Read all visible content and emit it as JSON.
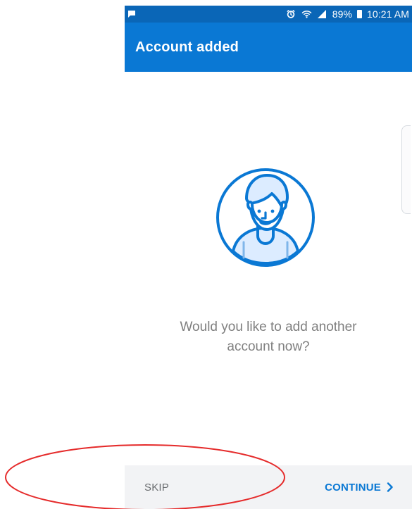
{
  "status_bar": {
    "battery_percent": "89%",
    "time": "10:21 AM",
    "icons": {
      "notification": "chat-bubble-icon",
      "alarm": "alarm-icon",
      "wifi": "wifi-icon",
      "signal": "signal-icon",
      "battery": "battery-icon"
    }
  },
  "app_bar": {
    "title": "Account added"
  },
  "main": {
    "avatar_icon": "person-avatar-icon",
    "message_line_1": "Would you like to add another",
    "message_line_2": "account now?"
  },
  "actions": {
    "skip_label": "SKIP",
    "continue_label": "CONTINUE",
    "continue_icon": "chevron-right-icon"
  },
  "colors": {
    "status_bar": "#0a66b7",
    "app_bar": "#0a78d4",
    "text_muted": "#7f7f7f",
    "button_blue": "#0a78d4",
    "bottom_bar_bg": "#f2f3f5",
    "annotation_red": "#e52b2b"
  }
}
